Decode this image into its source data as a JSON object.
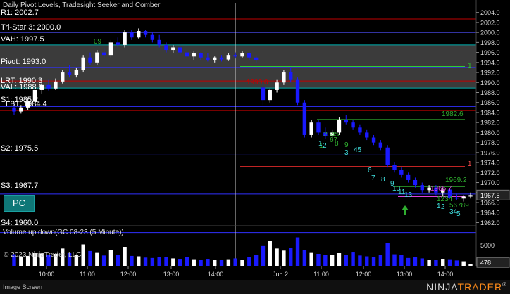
{
  "window": {
    "title": "Daily Pivot Levels, Tradesight Seeker and Comber",
    "footer_left": "Image Screen",
    "brand_part1": "NINJA",
    "brand_part2": "TRADER",
    "brand_mark": "®",
    "copyright": "© 2023 NinjaTrader, LLC"
  },
  "levels": [
    {
      "label": "R1: 2002.7",
      "value": 2002.7,
      "color": "#c00000"
    },
    {
      "label": "Tri-Star 3: 2000.0",
      "value": 2000.0,
      "color": "#5050ff"
    },
    {
      "label": "VAH: 1997.5",
      "value": 1997.5,
      "color": "#00b0b0"
    },
    {
      "label": "Pivot: 1993.0",
      "value": 1993.0,
      "color": "#3030ff"
    },
    {
      "label": "LRT: 1990.3",
      "value": 1990.3,
      "color": "#c00000"
    },
    {
      "label": "VAL: 1988.9",
      "value": 1988.9,
      "color": "#00b0b0"
    },
    {
      "label": "S1: 1985.2",
      "value": 1985.2,
      "color": "#3030ff"
    },
    {
      "label": "LBT: 1984.4",
      "value": 1984.4,
      "color": "#c00000"
    },
    {
      "label": "S2: 1975.5",
      "value": 1975.5,
      "color": "#3030ff"
    },
    {
      "label": "S3: 1967.7",
      "value": 1967.7,
      "color": "#3030ff"
    },
    {
      "label": "S4: 1960.0",
      "value": 1960.0,
      "color": "#3030ff"
    }
  ],
  "price_axis": {
    "ticks": [
      "2004.0",
      "2002.0",
      "2000.0",
      "1998.0",
      "1996.0",
      "1994.0",
      "1992.0",
      "1990.0",
      "1988.0",
      "1986.0",
      "1984.0",
      "1982.0",
      "1980.0",
      "1978.0",
      "1976.0",
      "1974.0",
      "1972.0",
      "1970.0",
      "1968.0",
      "1966.0",
      "1964.0",
      "1962.0"
    ],
    "current": "1967.5"
  },
  "volume_panel": {
    "title": "Volume up down(GC 08-23 (5 Minute))",
    "ticks": [
      "5000",
      "0"
    ],
    "current": "478"
  },
  "time_axis": [
    "10:00",
    "11:00",
    "12:00",
    "13:00",
    "14:00",
    "Jun 2",
    "11:00",
    "12:00",
    "13:00",
    "14:00"
  ],
  "annotations": [
    {
      "text": "1982.6",
      "color": "#2fae2f"
    },
    {
      "text": "1969.2",
      "color": "#2fae2f"
    },
    {
      "text": "1965.7",
      "color": "#e040e0"
    },
    {
      "text": "1990.0",
      "color": "#c00000"
    },
    {
      "text": "1",
      "color": "#2fd02f"
    },
    {
      "text": "1",
      "color": "#ff5050"
    },
    {
      "text": "09",
      "color": "#2fae2f"
    }
  ],
  "seq_labels": [
    {
      "text": "1",
      "color": "#2fae2f"
    },
    {
      "text": "2345",
      "color": "#2fae2f"
    },
    {
      "text": "67",
      "color": "#2fae2f"
    },
    {
      "text": "8",
      "color": "#2fae2f"
    },
    {
      "text": "9",
      "color": "#2fae2f"
    },
    {
      "text": "1",
      "color": "#40e0e0"
    },
    {
      "text": "2",
      "color": "#40e0e0"
    },
    {
      "text": "3",
      "color": "#40e0e0"
    },
    {
      "text": "45",
      "color": "#40e0e0"
    },
    {
      "text": "6",
      "color": "#40e0e0"
    },
    {
      "text": "7",
      "color": "#40e0e0"
    },
    {
      "text": "8",
      "color": "#40e0e0"
    },
    {
      "text": "9",
      "color": "#40e0e0"
    },
    {
      "text": "10",
      "color": "#40e0e0"
    },
    {
      "text": "11",
      "color": "#40e0e0"
    },
    {
      "text": "13",
      "color": "#40e0e0"
    },
    {
      "text": "1234",
      "color": "#2fae2f"
    },
    {
      "text": "56789",
      "color": "#2fae2f"
    },
    {
      "text": "1",
      "color": "#40e0e0"
    },
    {
      "text": "2",
      "color": "#40e0e0"
    },
    {
      "text": "34",
      "color": "#40e0e0"
    },
    {
      "text": "5",
      "color": "#40e0e0"
    }
  ],
  "pc_button": {
    "label": "PC"
  },
  "colors": {
    "bull_candle": "#ffffff",
    "bear_candle": "#1a1aff",
    "value_area": "#6b6b6b",
    "volume_up": "#ffffff",
    "volume_down": "#1a1aff",
    "arrow": "#2fae2f"
  },
  "candles": [
    [
      1985.0,
      1986.0,
      1983.5,
      1984.2
    ],
    [
      1984.2,
      1985.5,
      1983.8,
      1985.0
    ],
    [
      1985.0,
      1986.8,
      1984.5,
      1986.2
    ],
    [
      1986.2,
      1989.0,
      1986.0,
      1988.5
    ],
    [
      1988.5,
      1990.0,
      1987.8,
      1989.5
    ],
    [
      1989.5,
      1990.5,
      1988.4,
      1988.8
    ],
    [
      1988.8,
      1990.8,
      1988.5,
      1990.2
    ],
    [
      1990.2,
      1992.5,
      1989.8,
      1992.0
    ],
    [
      1992.0,
      1993.5,
      1991.0,
      1991.5
    ],
    [
      1991.5,
      1993.0,
      1991.0,
      1992.5
    ],
    [
      1992.5,
      1995.5,
      1992.0,
      1995.0
    ],
    [
      1995.0,
      1996.0,
      1993.5,
      1994.0
    ],
    [
      1994.0,
      1996.5,
      1993.5,
      1996.0
    ],
    [
      1996.0,
      1997.0,
      1995.0,
      1995.5
    ],
    [
      1995.5,
      1998.5,
      1995.0,
      1998.0
    ],
    [
      1998.0,
      1999.0,
      1997.0,
      1997.5
    ],
    [
      1997.5,
      2000.5,
      1997.0,
      2000.0
    ],
    [
      2000.0,
      2000.5,
      1998.5,
      1999.0
    ],
    [
      1999.0,
      2000.8,
      1998.8,
      2000.3
    ],
    [
      2000.3,
      2000.5,
      1999.0,
      1999.5
    ],
    [
      1999.5,
      2000.0,
      1998.0,
      1998.5
    ],
    [
      1998.5,
      1999.5,
      1997.0,
      1997.5
    ],
    [
      1997.5,
      1998.0,
      1996.0,
      1996.5
    ],
    [
      1996.5,
      1997.5,
      1995.8,
      1997.0
    ],
    [
      1997.0,
      1997.5,
      1995.5,
      1996.0
    ],
    [
      1996.0,
      1996.5,
      1994.8,
      1995.2
    ],
    [
      1995.2,
      1996.2,
      1994.5,
      1995.8
    ],
    [
      1995.8,
      1996.0,
      1994.5,
      1995.0
    ],
    [
      1995.0,
      1995.8,
      1994.2,
      1994.5
    ],
    [
      1994.5,
      1995.2,
      1994.0,
      1995.0
    ],
    [
      1995.0,
      1995.5,
      1994.2,
      1994.6
    ],
    [
      1994.6,
      1995.8,
      1994.3,
      1995.5
    ],
    [
      1995.5,
      1996.0,
      1994.8,
      1995.2
    ],
    [
      1995.2,
      1996.2,
      1995.0,
      1995.8
    ],
    [
      1995.8,
      1996.0,
      1994.5,
      1995.0
    ],
    [
      1995.0,
      1995.5,
      1994.0,
      1994.5
    ],
    [
      1989.0,
      1990.0,
      1985.5,
      1986.5
    ],
    [
      1986.5,
      1988.8,
      1986.0,
      1988.5
    ],
    [
      1988.5,
      1990.5,
      1988.0,
      1990.0
    ],
    [
      1990.0,
      1992.5,
      1989.5,
      1992.0
    ],
    [
      1992.0,
      1993.0,
      1990.0,
      1990.5
    ],
    [
      1990.5,
      1991.0,
      1985.5,
      1986.0
    ],
    [
      1986.0,
      1986.5,
      1979.0,
      1979.5
    ],
    [
      1979.5,
      1982.5,
      1979.0,
      1982.0
    ],
    [
      1982.0,
      1982.5,
      1979.5,
      1980.0
    ],
    [
      1980.0,
      1981.0,
      1978.8,
      1979.3
    ],
    [
      1979.3,
      1980.5,
      1978.5,
      1980.0
    ],
    [
      1980.0,
      1983.0,
      1979.5,
      1982.5
    ],
    [
      1982.5,
      1983.5,
      1981.5,
      1982.0
    ],
    [
      1982.0,
      1982.5,
      1980.5,
      1981.0
    ],
    [
      1981.0,
      1981.5,
      1979.5,
      1980.0
    ],
    [
      1980.0,
      1980.5,
      1978.5,
      1979.0
    ],
    [
      1979.0,
      1979.5,
      1977.5,
      1978.0
    ],
    [
      1978.0,
      1978.5,
      1976.5,
      1977.0
    ],
    [
      1977.0,
      1977.5,
      1973.0,
      1973.5
    ],
    [
      1973.5,
      1974.0,
      1972.0,
      1972.5
    ],
    [
      1972.5,
      1973.0,
      1971.0,
      1971.5
    ],
    [
      1971.5,
      1972.0,
      1970.0,
      1970.5
    ],
    [
      1970.5,
      1971.0,
      1969.0,
      1969.5
    ],
    [
      1969.5,
      1970.0,
      1968.0,
      1968.5
    ],
    [
      1968.5,
      1969.5,
      1968.0,
      1969.0
    ],
    [
      1969.0,
      1969.5,
      1967.5,
      1968.0
    ],
    [
      1968.0,
      1969.0,
      1967.2,
      1968.6
    ],
    [
      1968.6,
      1968.8,
      1966.8,
      1967.0
    ],
    [
      1967.0,
      1967.8,
      1966.5,
      1966.8
    ],
    [
      1966.8,
      1967.5,
      1966.2,
      1967.2
    ],
    [
      1967.2,
      1968.0,
      1966.8,
      1967.5
    ]
  ],
  "volumes": [
    2800,
    2200,
    2400,
    3200,
    3000,
    2600,
    2900,
    4200,
    3100,
    2700,
    5200,
    3600,
    3300,
    2500,
    3900,
    2600,
    4600,
    2400,
    2300,
    2000,
    1900,
    2200,
    2100,
    1800,
    1700,
    2100,
    1600,
    1500,
    1700,
    1400,
    1500,
    1600,
    1800,
    1500,
    2200,
    2600,
    4800,
    6100,
    4200,
    3700,
    4400,
    6900,
    3800,
    3300,
    2900,
    2700,
    2600,
    3100,
    2700,
    3400,
    2500,
    2300,
    2100,
    2700,
    5600,
    2800,
    2600,
    1900,
    2100,
    1800,
    1500,
    1400,
    1700,
    1600,
    1300,
    1100,
    478
  ],
  "levels_range": {
    "min": 1961.5,
    "max": 2004.8
  },
  "value_area_range": [
    1988.9,
    1997.5
  ]
}
